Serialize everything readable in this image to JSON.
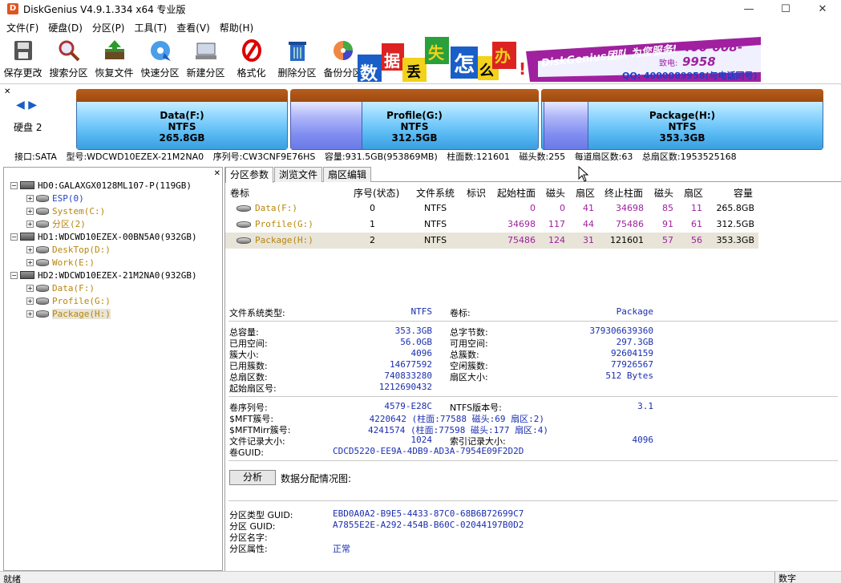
{
  "window": {
    "title": "DiskGenius V4.9.1.334 x64 专业版",
    "icon_letter": "D"
  },
  "menu": [
    "文件(F)",
    "硬盘(D)",
    "分区(P)",
    "工具(T)",
    "查看(V)",
    "帮助(H)"
  ],
  "toolbar": [
    {
      "label": "保存更改",
      "icon": "save-icon"
    },
    {
      "label": "搜索分区",
      "icon": "search-icon"
    },
    {
      "label": "恢复文件",
      "icon": "restore-icon"
    },
    {
      "label": "快速分区",
      "icon": "quick-partition-icon"
    },
    {
      "label": "新建分区",
      "icon": "new-partition-icon"
    },
    {
      "label": "格式化",
      "icon": "format-icon"
    },
    {
      "label": "删除分区",
      "icon": "delete-icon"
    },
    {
      "label": "备份分区",
      "icon": "backup-icon"
    }
  ],
  "banner": {
    "chars": [
      "数",
      "据",
      "丢",
      "失",
      "怎",
      "么",
      "办",
      "!"
    ],
    "slogan": "DiskGenius团队 为您服务!",
    "phone": "400-008-9958",
    "phone_label": "致电:",
    "qq": "QQ: 4000089958(与电话同号)"
  },
  "disk_panel": {
    "label": "硬盘 2",
    "partitions": [
      {
        "name": "Data(F:)",
        "fs": "NTFS",
        "size": "265.8GB",
        "used": 0.0,
        "selected": false
      },
      {
        "name": "Profile(G:)",
        "fs": "NTFS",
        "size": "312.5GB",
        "used": 0.25,
        "selected": false
      },
      {
        "name": "Package(H:)",
        "fs": "NTFS",
        "size": "353.3GB",
        "used": 0.16,
        "selected": true
      }
    ],
    "info": [
      "接口:SATA",
      "型号:WDCWD10EZEX-21M2NA0",
      "序列号:CW3CNF9E76HS",
      "容量:931.5GB(953869MB)",
      "柱面数:121601",
      "磁头数:255",
      "每道扇区数:63",
      "总扇区数:1953525168"
    ]
  },
  "tree": [
    {
      "level": 0,
      "type": "disk",
      "text": "HD0:GALAXGX0128ML107-P(119GB)"
    },
    {
      "level": 1,
      "type": "esp",
      "text": "ESP(0)"
    },
    {
      "level": 1,
      "type": "part",
      "text": "System(C:)"
    },
    {
      "level": 1,
      "type": "part",
      "text": "分区(2)"
    },
    {
      "level": 0,
      "type": "disk",
      "text": "HD1:WDCWD10EZEX-00BN5A0(932GB)"
    },
    {
      "level": 1,
      "type": "part",
      "text": "DeskTop(D:)"
    },
    {
      "level": 1,
      "type": "part",
      "text": "Work(E:)"
    },
    {
      "level": 0,
      "type": "disk",
      "text": "HD2:WDCWD10EZEX-21M2NA0(932GB)"
    },
    {
      "level": 1,
      "type": "part",
      "text": "Data(F:)"
    },
    {
      "level": 1,
      "type": "part",
      "text": "Profile(G:)"
    },
    {
      "level": 1,
      "type": "part",
      "text": "Package(H:)",
      "selected": true
    }
  ],
  "tabs": [
    "分区参数",
    "浏览文件",
    "扇区编辑"
  ],
  "table": {
    "headers": [
      "卷标",
      "序号(状态)",
      "文件系统",
      "标识",
      "起始柱面",
      "磁头",
      "扇区",
      "终止柱面",
      "磁头",
      "扇区",
      "容量"
    ],
    "rows": [
      {
        "name": "Data(F:)",
        "index": "0",
        "fs": "NTFS",
        "flag": "",
        "start_cyl": "0",
        "start_head": "0",
        "start_sec": "41",
        "end_cyl": "34698",
        "end_head": "85",
        "end_sec": "11",
        "size": "265.8GB",
        "selected": false
      },
      {
        "name": "Profile(G:)",
        "index": "1",
        "fs": "NTFS",
        "flag": "",
        "start_cyl": "34698",
        "start_head": "117",
        "start_sec": "44",
        "end_cyl": "75486",
        "end_head": "91",
        "end_sec": "61",
        "size": "312.5GB",
        "selected": false
      },
      {
        "name": "Package(H:)",
        "index": "2",
        "fs": "NTFS",
        "flag": "",
        "start_cyl": "75486",
        "start_head": "124",
        "start_sec": "31",
        "end_cyl": "121601",
        "end_head": "57",
        "end_sec": "56",
        "size": "353.3GB",
        "selected": true
      }
    ]
  },
  "details": {
    "fs_type_label": "文件系统类型:",
    "fs_type": "NTFS",
    "volume_label": "卷标:",
    "volume": "Package",
    "total_label": "总容量:",
    "total": "353.3GB",
    "total_bytes_label": "总字节数:",
    "total_bytes": "379306639360",
    "used_label": "已用空间:",
    "used": "56.0GB",
    "free_label": "可用空间:",
    "free": "297.3GB",
    "cluster_label": "簇大小:",
    "cluster": "4096",
    "total_clusters_label": "总簇数:",
    "total_clusters": "92604159",
    "used_clusters_label": "已用簇数:",
    "used_clusters": "14677592",
    "free_clusters_label": "空闲簇数:",
    "free_clusters": "77926567",
    "total_sectors_label": "总扇区数:",
    "total_sectors": "740833280",
    "sector_size_label": "扇区大小:",
    "sector_size": "512 Bytes",
    "start_sector_label": "起始扇区号:",
    "start_sector": "1212690432",
    "serial_label": "卷序列号:",
    "serial": "4579-E28C",
    "ntfs_ver_label": "NTFS版本号:",
    "ntfs_ver": "3.1",
    "mft_label": "$MFT簇号:",
    "mft": "4220642 (柱面:77588 磁头:69 扇区:2)",
    "mftmirr_label": "$MFTMirr簇号:",
    "mftmirr": "4241574 (柱面:77598 磁头:177 扇区:4)",
    "record_label": "文件记录大小:",
    "record": "1024",
    "index_label": "索引记录大小:",
    "index": "4096",
    "guid_label": "卷GUID:",
    "guid": "CDCD5220-EE9A-4DB9-AD3A-7954E09F2D2D",
    "analyze_btn": "分析",
    "analyze_label": "数据分配情况图:",
    "ptype_guid_label": "分区类型 GUID:",
    "ptype_guid": "EBD0A0A2-B9E5-4433-87C0-68B6B72699C7",
    "part_guid_label": "分区 GUID:",
    "part_guid": "A7855E2E-A292-454B-B60C-02044197B0D2",
    "part_name_label": "分区名字:",
    "part_name": "",
    "part_attr_label": "分区属性:",
    "part_attr": "正常"
  },
  "status": {
    "left": "就绪",
    "right": "数字"
  }
}
